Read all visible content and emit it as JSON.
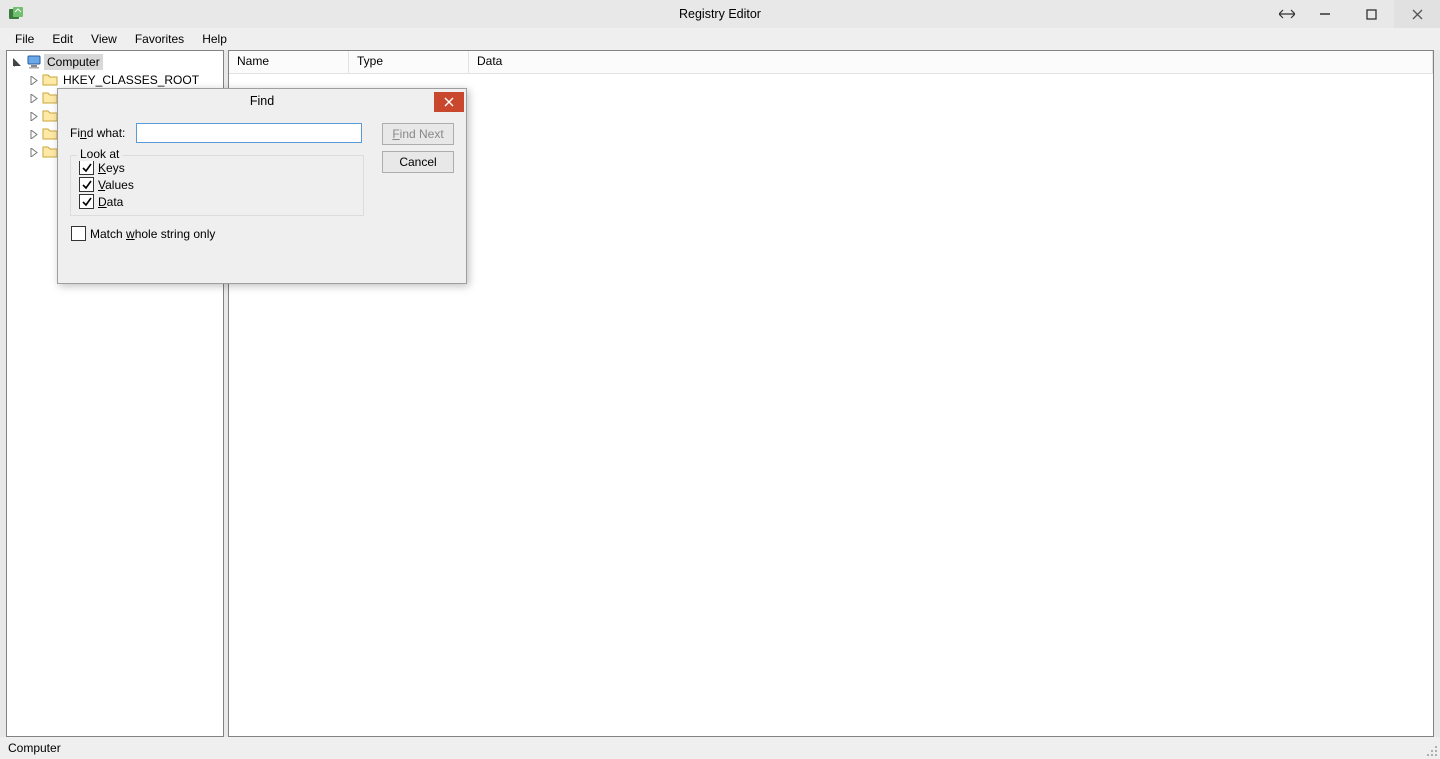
{
  "window": {
    "title": "Registry Editor"
  },
  "menu": {
    "file": "File",
    "edit": "Edit",
    "view": "View",
    "favorites": "Favorites",
    "help": "Help"
  },
  "tree": {
    "root": "Computer",
    "child0": "HKEY_CLASSES_ROOT"
  },
  "list": {
    "col_name": "Name",
    "col_type": "Type",
    "col_data": "Data"
  },
  "status": {
    "path": "Computer"
  },
  "dialog": {
    "title": "Find",
    "find_what_label_pre": "Fi",
    "find_what_label_u": "n",
    "find_what_label_post": "d what:",
    "find_what_value": "",
    "find_next_pre": "",
    "find_next_u": "F",
    "find_next_post": "ind Next",
    "cancel": "Cancel",
    "look_at": "Look at",
    "keys_u": "K",
    "keys_post": "eys",
    "values_u": "V",
    "values_post": "alues",
    "data_u": "D",
    "data_post": "ata",
    "match_pre": "Match ",
    "match_u": "w",
    "match_post": "hole string only",
    "keys_checked": true,
    "values_checked": true,
    "data_checked": true,
    "match_checked": false
  }
}
